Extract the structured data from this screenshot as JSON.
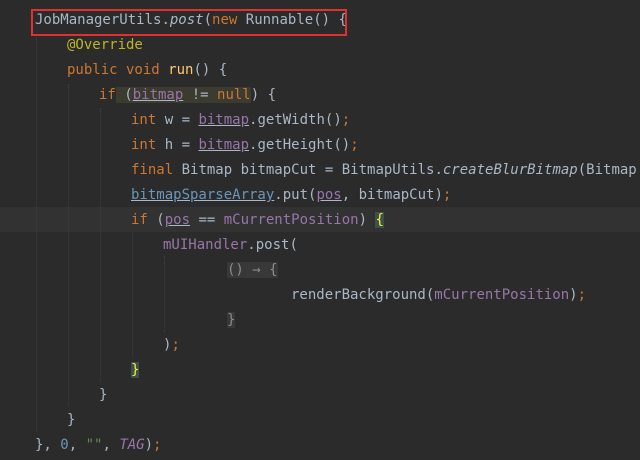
{
  "code": {
    "l1": {
      "class": "JobManagerUtils",
      "dot": ".",
      "method": "post",
      "open": "(",
      "kw_new": "new",
      "sp": " ",
      "type": "Runnable",
      "rest": "() {"
    },
    "l2": {
      "annotation": "@Override"
    },
    "l3": {
      "kw": "public void",
      "sp": " ",
      "name": "run",
      "rest": "() {"
    },
    "l4": {
      "kw_if": "if",
      "open": " (",
      "field": "bitmap",
      "op": " != ",
      "kw_null": "null",
      "close": ") {"
    },
    "l5": {
      "kw_int": "int",
      "decl": " w = ",
      "field": "bitmap",
      "call": ".getWidth()",
      "semi": ";"
    },
    "l6": {
      "kw_int": "int",
      "decl": " h = ",
      "field": "bitmap",
      "call": ".getHeight()",
      "semi": ";"
    },
    "l7": {
      "kw_final": "final",
      "decl": " Bitmap bitmapCut = BitmapUtils.",
      "static_call": "createBlurBitmap",
      "rest": "(Bitmap.cre"
    },
    "l8": {
      "field": "bitmapSparseArray",
      "call": ".put(",
      "param": "pos",
      "rest": ", bitmapCut)",
      "semi": ";"
    },
    "l9": {
      "kw_if": "if",
      "open": " (",
      "param": "pos",
      "op": " == ",
      "field": "mCurrentPosition",
      "close": ") ",
      "brace": "{"
    },
    "l10": {
      "field": "mUIHandler",
      "call": ".post("
    },
    "l11": {
      "lambda": "() → {"
    },
    "l12": {
      "call": "renderBackground(",
      "field": "mCurrentPosition",
      "close": ")",
      "semi": ";"
    },
    "l13": {
      "brace": "}"
    },
    "l14": {
      "close": ")",
      "semi": ";"
    },
    "l15": {
      "brace": "}"
    },
    "l16": {
      "brace": "}"
    },
    "l17": {
      "brace": "}"
    },
    "l18": {
      "pre": "}, ",
      "num": "0",
      "comma": ", ",
      "str": "\"\"",
      "comma2": ", ",
      "const": "TAG",
      "close": ")",
      "semi": ";"
    }
  },
  "colors": {
    "background": "#2b2b2b",
    "keyword": "#cc7832",
    "annotation": "#bbb529",
    "field": "#9876aa",
    "string": "#6a8759",
    "number": "#6897bb",
    "text": "#a9b7c6",
    "highlight_box": "#e03131"
  }
}
